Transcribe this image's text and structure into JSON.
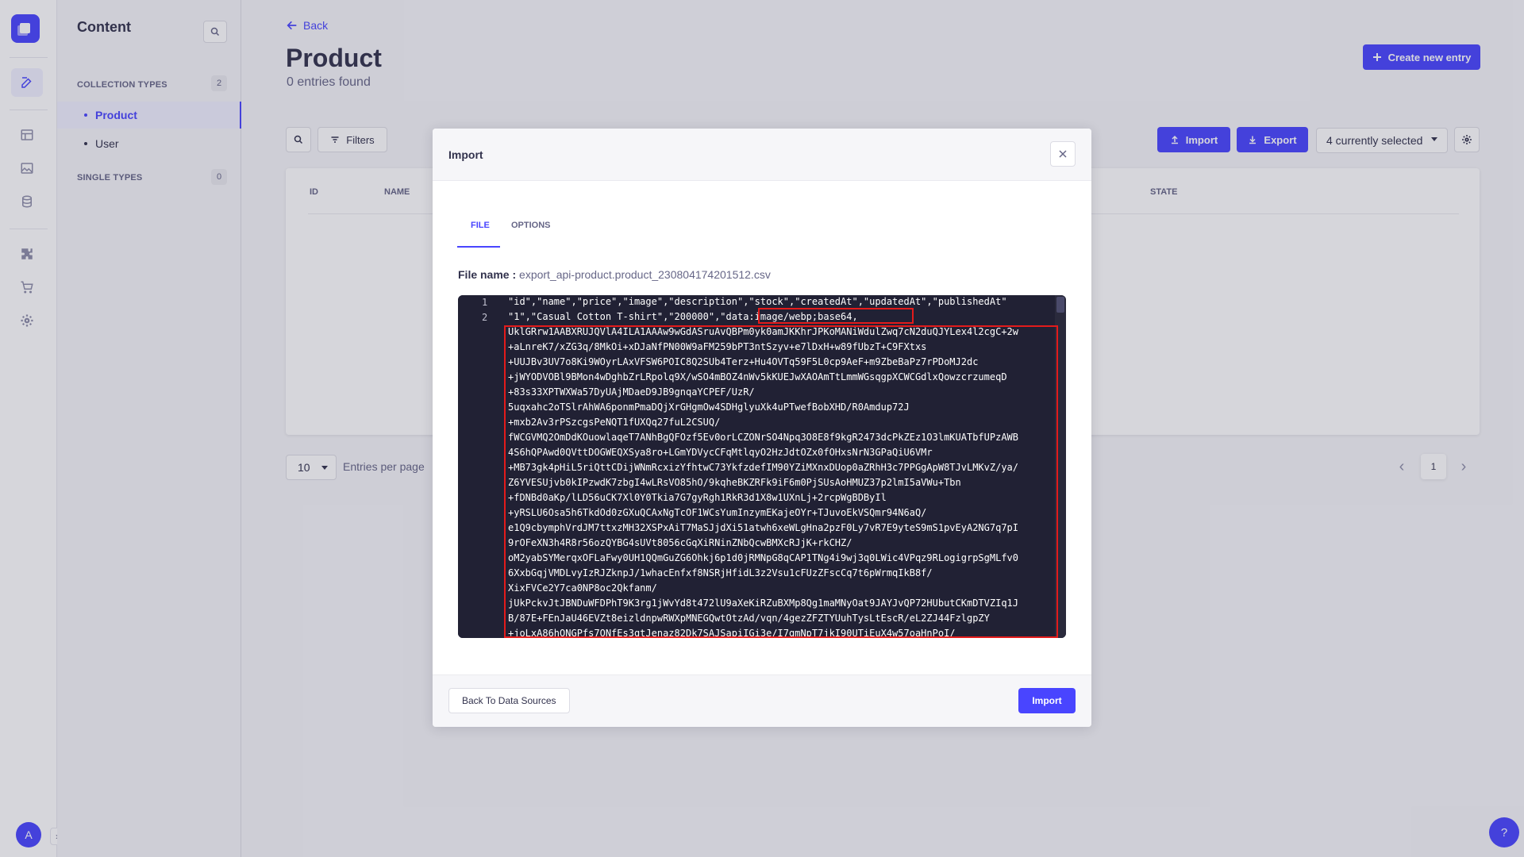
{
  "sidebar_rail": {
    "icons": [
      "content-manager-icon",
      "content-type-builder-icon",
      "media-library-icon",
      "data-sources-icon",
      "plugins-icon",
      "marketplace-icon",
      "settings-icon"
    ],
    "avatar_initial": "A",
    "expand_glyph": "›"
  },
  "content_nav": {
    "title": "Content",
    "collection_types_label": "COLLECTION TYPES",
    "collection_types_count": "2",
    "collection_items": [
      "Product",
      "User"
    ],
    "single_types_label": "SINGLE TYPES",
    "single_types_count": "0"
  },
  "header": {
    "back_label": "Back",
    "title": "Product",
    "subtitle": "0 entries found",
    "create_label": "Create new entry"
  },
  "toolbar": {
    "filters_label": "Filters",
    "import_label": "Import",
    "export_label": "Export",
    "columns_selected": "4 currently selected"
  },
  "table": {
    "columns": [
      "ID",
      "NAME",
      "STATE"
    ]
  },
  "pagination": {
    "per_page_value": "10",
    "per_page_label": "Entries per page",
    "current_page": "1"
  },
  "help_label": "?",
  "modal": {
    "title": "Import",
    "tabs": [
      "FILE",
      "OPTIONS"
    ],
    "active_tab": "FILE",
    "file_name_label": "File name :",
    "file_name": "export_api-product.product_230804174201512.csv",
    "line_numbers": [
      "1",
      "2"
    ],
    "code_lines": [
      "\"id\",\"name\",\"price\",\"image\",\"description\",\"stock\",\"createdAt\",\"updatedAt\",\"publishedAt\"",
      "\"1\",\"Casual Cotton T-shirt\",\"200000\",\"data:image/webp;base64,",
      "UklGRrw1AABXRUJQVlA4ILA1AAAw9wGdASruAvQBPm0yk0amJKKhrJPKoMANiWdulZwq7cN2duQJYLex4l2cgC+2w",
      "+aLnreK7/xZG3q/8MkOi+xDJaNfPN00W9aFM259bPT3ntSzyv+e7lDxH+w89fUbzT+C9FXtxs",
      "+UUJBv3UV7o8Ki9WOyrLAxVFSW6POIC8Q2SUb4Terz+Hu4OVTq59F5L0cp9AeF+m9ZbeBaPz7rPDoMJ2dc",
      "+jWYODVOBl9BMon4wDghbZrLRpolq9X/wSO4mBOZ4nWv5kKUEJwXAOAmTtLmmWGsqgpXCWCGdlxQowzcrzumeqD",
      "+83s33XPTWXWa57DyUAjMDaeD9JB9gnqaYCPEF/UzR/",
      "5uqxahc2oTSlrAhWA6ponmPmaDQjXrGHgmOw4SDHglyuXk4uPTwefBobXHD/R0Amdup72J",
      "+mxb2Av3rPSzcgsPeNQT1fUXQq27fuL2CSUQ/",
      "fWCGVMQ2OmDdKOuowlaqeT7ANhBgQFOzf5Ev0orLCZONrSO4Npq3O8E8f9kgR2473dcPkZEz1O3lmKUATbfUPzAWB",
      "4S6hQPAwd0QVttDOGWEQXSya8ro+LGmYDVycCFqMtlqyO2HzJdtOZx0fOHxsNrN3GPaQiU6VMr",
      "+MB73gk4pHiL5riQttCDijWNmRcxizYfhtwC73YkfzdefIM90YZiMXnxDUop0aZRhH3c7PPGgApW8TJvLMKvZ/ya/",
      "Z6YVESUjvb0kIPzwdK7zbgI4wLRsVO85hO/9kqheBKZRFk9iF6m0PjSUsAoHMUZ37p2lmI5aVWu+Tbn",
      "+fDNBd0aKp/lLD56uCK7Xl0Y0Tkia7G7gyRgh1RkR3d1X8w1UXnLj+2rcpWgBDByIl",
      "+yRSLU6Osa5h6TkdOd0zGXuQCAxNgTcOF1WCsYumInzymEKajeOYr+TJuvoEkVSQmr94N6aQ/",
      "e1Q9cbymphVrdJM7ttxzMH32XSPxAiT7MaSJjdXi51atwh6xeWLgHna2pzF0Ly7vR7E9yteS9mS1pvEyA2NG7q7pI",
      "9rOFeXN3h4R8r56ozQYBG4sUVt8056cGqXiRNinZNbQcwBMXcRJjK+rkCHZ/",
      "oM2yabSYMerqxOFLaFwy0UH1QQmGuZG6Ohkj6p1d0jRMNpG8qCAP1TNg4i9wj3q0LWic4VPqz9RLogigrpSgMLfv0",
      "6XxbGqjVMDLvyIzRJZknpJ/1whacEnfxf8NSRjHfidL3z2Vsu1cFUzZFscCq7t6pWrmqIkB8f/",
      "XixFVCe2Y7ca0NP8oc2Qkfanm/",
      "jUkPckvJtJBNDuWFDPhT9K3rg1jWvYd8t472lU9aXeKiRZuBXMp8Qg1maMNyOat9JAYJvQP72HUbutCKmDTVZIq1J",
      "B/87E+FEnJaU46EVZt8eizldnpwRWXpMNEGQwtOtzAd/vqn/4gezZFZTYUuhTysLtEscR/eL2ZJ44FzlgpZY",
      "+joLxA86hONGPfs7ONfEs3gtJenaz82Dk7SAJSapiIGi3e/I7gmNpT7jkI90UTiEuX4w57oaHnPoI/"
    ],
    "back_button": "Back To Data Sources",
    "import_button": "Import"
  }
}
